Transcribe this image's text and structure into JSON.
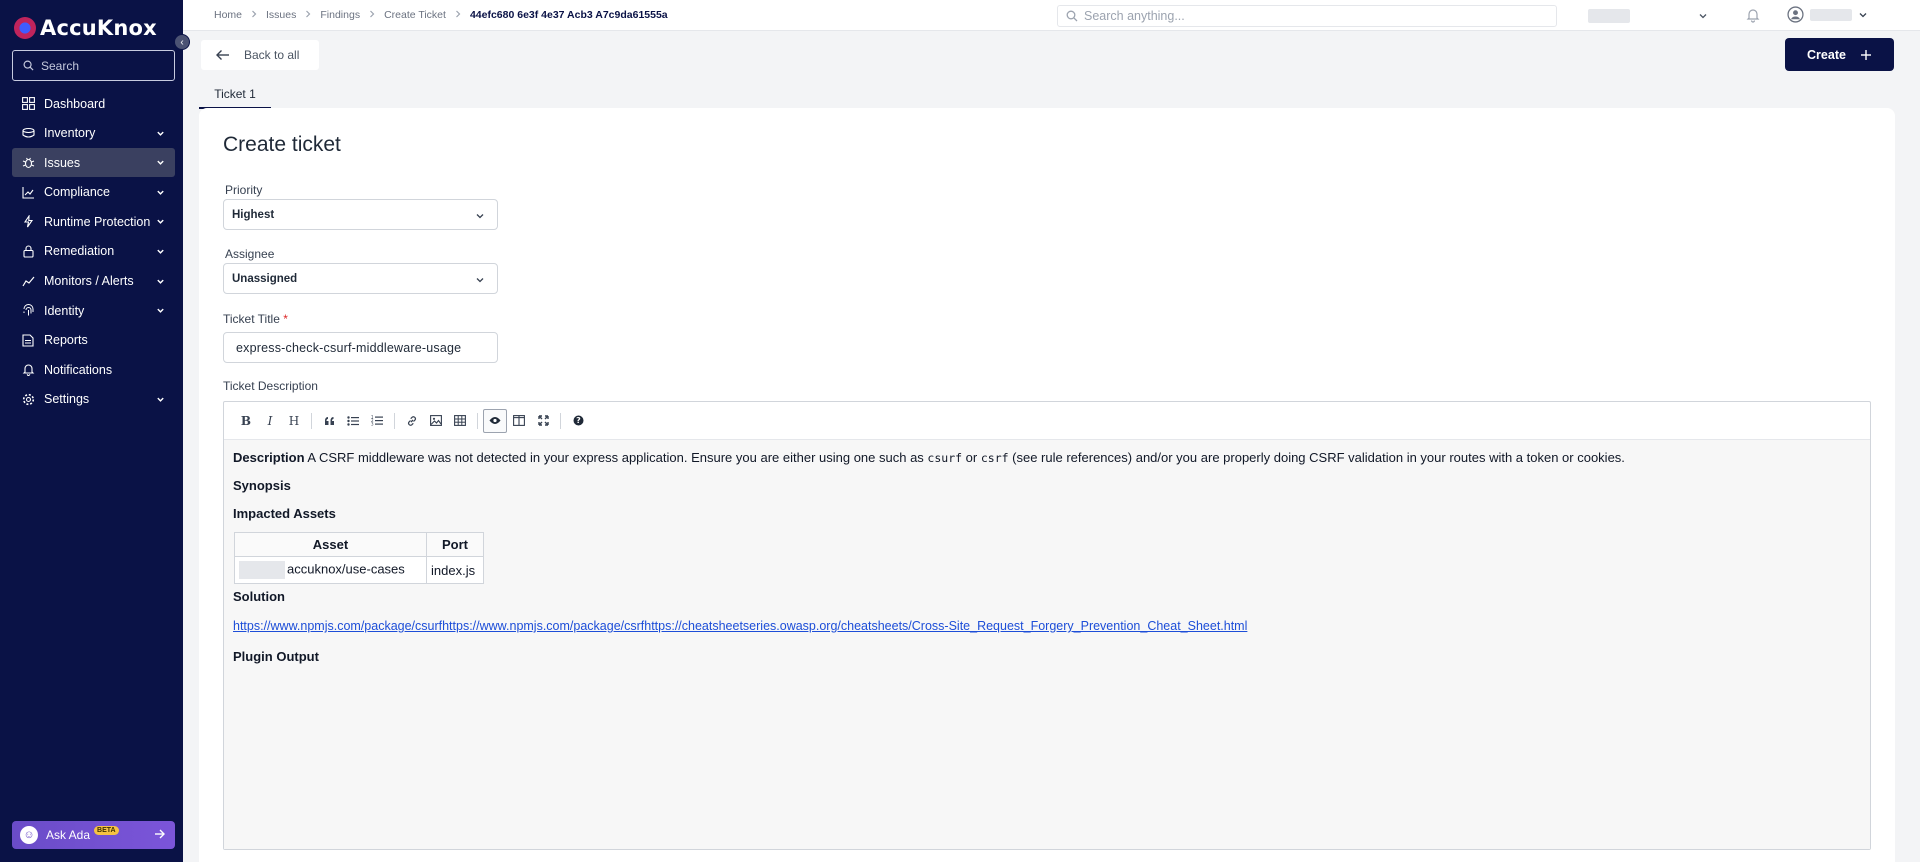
{
  "app": {
    "logo_text": "AccuKnox",
    "accent_color": "#0a1246"
  },
  "sidebar": {
    "search_placeholder": "Search",
    "items": [
      {
        "label": "Dashboard",
        "icon": "dashboard-icon",
        "expandable": false
      },
      {
        "label": "Inventory",
        "icon": "inventory-icon",
        "expandable": true
      },
      {
        "label": "Issues",
        "icon": "bug-icon",
        "expandable": true,
        "active": true
      },
      {
        "label": "Compliance",
        "icon": "compliance-icon",
        "expandable": true
      },
      {
        "label": "Runtime Protection",
        "icon": "runtime-icon",
        "expandable": true
      },
      {
        "label": "Remediation",
        "icon": "remediation-icon",
        "expandable": true
      },
      {
        "label": "Monitors / Alerts",
        "icon": "monitor-icon",
        "expandable": true
      },
      {
        "label": "Identity",
        "icon": "fingerprint-icon",
        "expandable": true
      },
      {
        "label": "Reports",
        "icon": "reports-icon",
        "expandable": false
      },
      {
        "label": "Notifications",
        "icon": "bell-icon",
        "expandable": false
      },
      {
        "label": "Settings",
        "icon": "gear-icon",
        "expandable": true
      }
    ],
    "ask_ada": {
      "label": "Ask Ada",
      "badge": "BETA"
    }
  },
  "topbar": {
    "breadcrumbs": [
      "Home",
      "Issues",
      "Findings",
      "Create Ticket"
    ],
    "breadcrumb_current": "44efc680 6e3f 4e37 Acb3 A7c9da61555a",
    "search_placeholder": "Search anything..."
  },
  "subheader": {
    "back_label": "Back to all",
    "create_label": "Create",
    "tab_label": "Ticket 1"
  },
  "form": {
    "heading": "Create ticket",
    "priority_label": "Priority",
    "priority_value": "Highest",
    "assignee_label": "Assignee",
    "assignee_value": "Unassigned",
    "title_label": "Ticket Title",
    "title_required_mark": "*",
    "title_value": "express-check-csurf-middleware-usage",
    "description_label": "Ticket Description"
  },
  "editor": {
    "toolbar": [
      "bold-icon",
      "italic-icon",
      "heading-icon",
      "quote-icon",
      "unordered-list-icon",
      "ordered-list-icon",
      "link-icon",
      "image-icon",
      "table-icon",
      "preview-icon",
      "side-by-side-icon",
      "fullscreen-icon",
      "help-icon"
    ],
    "description_heading": "Description",
    "description_part1": " A CSRF middleware was not detected in your express application. Ensure you are either using one such as ",
    "code1": "csurf",
    "description_part2": " or ",
    "code2": "csrf",
    "description_part3": " (see rule references) and/or you are properly doing CSRF validation in your routes with a token or cookies.",
    "synopsis_heading": "Synopsis",
    "impacted_heading": "Impacted Assets",
    "table": {
      "headers": [
        "Asset",
        "Port"
      ],
      "rows": [
        [
          "accuknox/use-cases",
          "index.js"
        ]
      ]
    },
    "solution_heading": "Solution",
    "solution_link": "https://www.npmjs.com/package/csurfhttps://www.npmjs.com/package/csrfhttps://cheatsheetseries.owasp.org/cheatsheets/Cross-Site_Request_Forgery_Prevention_Cheat_Sheet.html",
    "plugin_heading": "Plugin Output"
  }
}
